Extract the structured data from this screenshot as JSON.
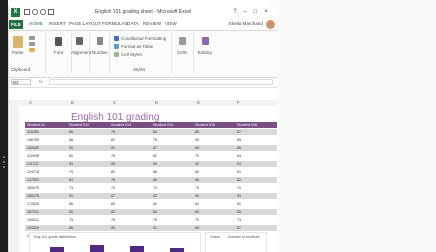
{
  "window": {
    "title": "English 101 grading sheet - Microsoft Excel"
  },
  "ribbon": {
    "tabs": [
      "FILE",
      "HOME",
      "INSERT",
      "PAGE LAYOUT",
      "FORMULAS",
      "DATA",
      "REVIEW",
      "VIEW"
    ],
    "user": "Sheila Marchand",
    "groups": {
      "clipboard_label": "Clipboard",
      "paste": "Paste",
      "font": "Font",
      "alignment": "Alignment",
      "number": "Number",
      "conditional_formatting": "Conditional Formatting",
      "format_as_table": "Format as Table",
      "cell_styles": "Cell Styles",
      "styles_label": "Styles",
      "cells": "Cells",
      "editing": "Editing"
    }
  },
  "formula_bar": {
    "name_box": "B3",
    "fx": "fx"
  },
  "columns": [
    "A",
    "B",
    "C",
    "D",
    "E",
    "F"
  ],
  "sheet": {
    "title": "English 101 grading",
    "headers": [
      "Student ID",
      "Student ID2",
      "Student ID3",
      "Student ID4",
      "Student ID5",
      "Student ID6"
    ],
    "rows": [
      [
        "115365",
        "86",
        "76",
        "84",
        "88",
        "87"
      ],
      [
        "156789",
        "88",
        "82",
        "75",
        "90",
        "85"
      ],
      [
        "162000",
        "90",
        "91",
        "87",
        "89",
        "88"
      ],
      [
        "210598",
        "80",
        "78",
        "82",
        "79",
        "84"
      ],
      [
        "211237",
        "93",
        "95",
        "90",
        "92",
        "94"
      ],
      [
        "124718",
        "79",
        "80",
        "86",
        "80",
        "81"
      ],
      [
        "147593",
        "84",
        "76",
        "88",
        "86",
        "82"
      ],
      [
        "183475",
        "73",
        "70",
        "74",
        "75",
        "70"
      ],
      [
        "185178",
        "91",
        "87",
        "92",
        "90",
        "93"
      ],
      [
        "172628",
        "86",
        "85",
        "80",
        "84",
        "82"
      ],
      [
        "187201",
        "80",
        "82",
        "84",
        "80",
        "85"
      ],
      [
        "190011",
        "75",
        "78",
        "76",
        "79",
        "73"
      ],
      [
        "194326",
        "88",
        "90",
        "91",
        "89",
        "87"
      ],
      [
        "198511",
        "84",
        "86",
        "82",
        "85",
        "83"
      ]
    ]
  },
  "chart": {
    "title": "Eng 101 grade distribution"
  },
  "side_panel": {
    "col1": "Grade",
    "col2": "Number of students"
  },
  "colors": {
    "excel_green": "#217346",
    "header_purple": "#7b4e86",
    "title_purple": "#9b6aa5",
    "bar_purple": "#4c2a86"
  }
}
